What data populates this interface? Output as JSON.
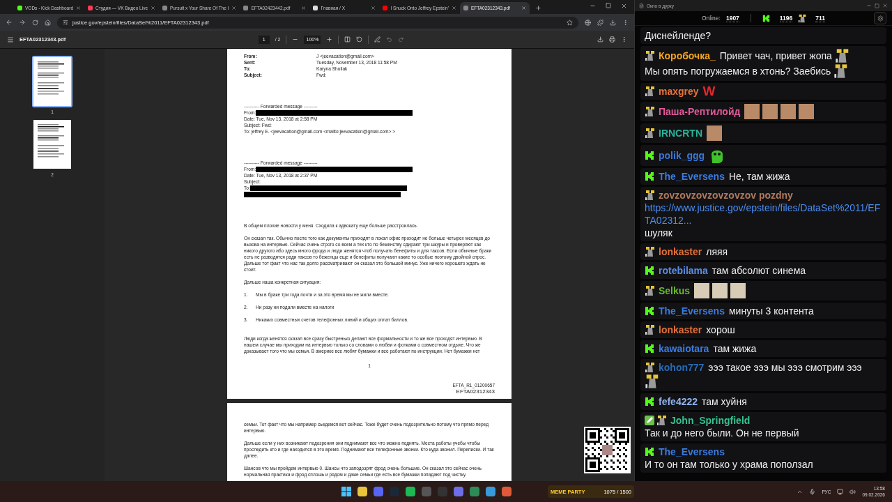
{
  "browser": {
    "tabs": [
      {
        "title": "VODs - Kick Dashboard",
        "selected": false
      },
      {
        "title": "Студия — VK Видео Live",
        "selected": false
      },
      {
        "title": "Pursuit x Your Share Of The I",
        "selected": false
      },
      {
        "title": "EFTA02423442.pdf",
        "selected": false
      },
      {
        "title": "Главная / X",
        "selected": false
      },
      {
        "title": "I Snuck Onto Jeffrey Epstein'",
        "selected": false
      },
      {
        "title": "EFTA02312343.pdf",
        "selected": true
      }
    ],
    "address": "justice.gov/epstein/files/DataSet%2011/EFTA02312343.pdf",
    "pdf_toolbar": {
      "title": "EFTA02312343.pdf",
      "page": "1",
      "page_total": "/ 2",
      "zoom": "100%"
    },
    "thumbnails": [
      {
        "label": "1",
        "selected": true
      },
      {
        "label": "2",
        "selected": false
      }
    ]
  },
  "document": {
    "pages": [
      {
        "blocks": [
          {
            "kind": "fields",
            "rows": [
              {
                "label": "From:",
                "value": "J <jeevacation@gmail.com>"
              },
              {
                "label": "Sent:",
                "value": "Tuesday, November 13, 2018 11:58 PM"
              },
              {
                "label": "To:",
                "value": "Karyna Shuliak"
              },
              {
                "label": "Subject:",
                "value": "Fwd:"
              }
            ]
          },
          {
            "kind": "forward",
            "lines": [
              {
                "text": "---------- Forwarded message ---------",
                "redacted": false
              },
              {
                "text": "From:",
                "redacted": true
              },
              {
                "text": "Date: Tue, Nov 13, 2018 at 2:58 PM",
                "redacted": false
              },
              {
                "text": "Subject: Fwd:",
                "redacted": false
              },
              {
                "text": "To: jeffrey E. <jeevacation@gmail.com <mailto:jeevacation@gmail.com> >",
                "redacted": false
              }
            ]
          },
          {
            "kind": "forward",
            "lines": [
              {
                "text": "---------- Forwarded message ---------",
                "redacted": false
              },
              {
                "text": "From:",
                "redacted": true
              },
              {
                "text": "Date: Tue, Nov 13, 2018 at 2:37 PM",
                "redacted": false
              },
              {
                "text": "Subject:",
                "redacted": false
              },
              {
                "text": "To:",
                "redacted": true
              },
              {
                "redacted": true
              }
            ]
          },
          {
            "kind": "paragraph",
            "text": "В общем плохие новости у меня. Сходила к адвокату еще больше расстроилась."
          },
          {
            "kind": "paragraph",
            "text": "Он сказал так. Обычно после того как документы приходят в локал офис проходит не больше четырех месяцев до вызова на интервью. Сейчас очень строго со всем а тех кто по беженству сдирают три шкуры и проверяют как никого другого ибо здесь много фрода и люди женятся чтоб получать бенефиты и для таксов. Если обычные браки есть не разводятся ради таксов то беженцы еще и бенефиты получают какие то особые поэтому двойной спрос. Дальше тот факт что нас так долго рассматривают он сказал это большой минус. Уже ничего хорошего ждать не стоит."
          },
          {
            "kind": "paragraph",
            "text": "Дальше наша конкретная ситуация:"
          },
          {
            "kind": "list",
            "items": [
              {
                "number": "1.",
                "text": "Мы в браке три года почти и за это время мы не жили вместе."
              },
              {
                "number": "2.",
                "text": "Ни разу ни подали вместе на налоги"
              },
              {
                "number": "3.",
                "text": "Никаких совместных счетов телефонных линий и общих оплат биллов."
              }
            ]
          },
          {
            "kind": "paragraph",
            "text": "Люди когда женятся сказал все сразу быстренько делают все формальности и то же все проходят интервью. В нашем случае мы приходим на интервью только со словами о любви и фотками о совместном отдыхе. Что же доказывает того что мы семья. В америке все любят бумажки и все работают по инструкции. Нет бумажки нет"
          },
          {
            "kind": "page_number",
            "text": "1"
          },
          {
            "kind": "footer",
            "lines": [
              "EFTA_R1_01200657",
              "EFTA02312343"
            ]
          }
        ]
      },
      {
        "blocks": [
          {
            "kind": "paragraph",
            "text": "семьи. Тот факт что мы например сьедемся вот сейчас. Тоже будет очень подозрительно потому что прямо перед интервью."
          },
          {
            "kind": "paragraph",
            "text": "Дальше если у них возникают подозрения они поднимают все что можно поднять. Места работы учебы чтобы проследить кто и где находился в это время. Поднимают все телефонные звонки. Кто куда звонил. Переписки. И так далее."
          },
          {
            "kind": "paragraph",
            "text": "Шансов что мы пройдем интервью 0. Шансы что заподозрят фрод очень большие. Он сказал это сейчас очень нормальная практика и фрод сплошь и рядом и даже семьи где есть все бумажки попадают под чистку."
          }
        ]
      }
    ]
  },
  "chat": {
    "window_title": "Окно в дурку",
    "online_label": "Online:",
    "online": "1907",
    "kick_count": "1196",
    "figure_count": "711",
    "messages": [
      {
        "parts": [
          {
            "kind": "text",
            "text": "Диснейленде?"
          }
        ]
      },
      {
        "badges": [
          {
            "kind": "figure"
          }
        ],
        "user": "Коробочка_",
        "color": "#f5a623",
        "parts": [
          {
            "kind": "text",
            "text": "Привет чач, привет жопа"
          },
          {
            "kind": "figure"
          },
          {
            "kind": "text",
            "text": "Мы опять погружаемся в хтонь? Заебись"
          },
          {
            "kind": "figure"
          }
        ]
      },
      {
        "badges": [
          {
            "kind": "figure"
          }
        ],
        "user": "maxgrey",
        "color": "#e8743b",
        "parts": [
          {
            "kind": "big_letter",
            "text": "W"
          }
        ]
      },
      {
        "badges": [
          {
            "kind": "figure"
          }
        ],
        "user": "Паша-Рептилойд",
        "color": "#e05a9a",
        "parts": [
          {
            "kind": "face"
          },
          {
            "kind": "face"
          },
          {
            "kind": "face"
          },
          {
            "kind": "face"
          }
        ]
      },
      {
        "badges": [
          {
            "kind": "figure"
          }
        ],
        "user": "IRNCRTN",
        "color": "#2bb39a",
        "parts": [
          {
            "kind": "face"
          }
        ]
      },
      {
        "badges": [
          {
            "kind": "kick"
          }
        ],
        "user": "polik_ggg",
        "color": "#3b78d8",
        "parts": [
          {
            "kind": "blob"
          }
        ]
      },
      {
        "badges": [
          {
            "kind": "kick"
          }
        ],
        "user": "The_Eversens",
        "color": "#3b7be0",
        "parts": [
          {
            "kind": "text",
            "text": "Не, там жижа"
          }
        ]
      },
      {
        "badges": [
          {
            "kind": "figure"
          }
        ],
        "user": "zovzovzovzovzovzov pozdny",
        "color": "#b07a5e",
        "parts": [
          {
            "kind": "link",
            "text": "https://www.justice.gov/epstein/files/DataSet%2011/EFTA02312..."
          },
          {
            "kind": "text",
            "text": "шуляк"
          }
        ]
      },
      {
        "badges": [
          {
            "kind": "figure"
          }
        ],
        "user": "lonkaster",
        "color": "#e2703a",
        "parts": [
          {
            "kind": "text",
            "text": "ляяя"
          }
        ]
      },
      {
        "badges": [
          {
            "kind": "kick"
          }
        ],
        "user": "rotebilama",
        "color": "#5b8ee6",
        "parts": [
          {
            "kind": "text",
            "text": "там абсолют синема"
          }
        ]
      },
      {
        "badges": [
          {
            "kind": "figure"
          }
        ],
        "user": "Selkus",
        "color": "#69b832",
        "parts": [
          {
            "kind": "cat"
          },
          {
            "kind": "cat"
          },
          {
            "kind": "cat"
          }
        ]
      },
      {
        "badges": [
          {
            "kind": "kick"
          }
        ],
        "user": "The_Eversens",
        "color": "#3b7be0",
        "parts": [
          {
            "kind": "text",
            "text": "минуты 3 контента"
          }
        ]
      },
      {
        "badges": [
          {
            "kind": "figure"
          }
        ],
        "user": "lonkaster",
        "color": "#e2703a",
        "parts": [
          {
            "kind": "text",
            "text": "хорош"
          }
        ]
      },
      {
        "badges": [
          {
            "kind": "kick"
          }
        ],
        "user": "kawaiotara",
        "color": "#3b7be0",
        "parts": [
          {
            "kind": "text",
            "text": "там жижа"
          }
        ]
      },
      {
        "badges": [
          {
            "kind": "figure"
          }
        ],
        "user": "kohon777",
        "color": "#2a6ab5",
        "parts": [
          {
            "kind": "text",
            "text": "эээ такое эээ мы эээ смотрим эээ"
          },
          {
            "kind": "figure"
          }
        ]
      },
      {
        "badges": [
          {
            "kind": "kick"
          }
        ],
        "user": "fefe4222",
        "color": "#8fb3f0",
        "parts": [
          {
            "kind": "text",
            "text": "там хуйня"
          }
        ]
      },
      {
        "badges": [
          {
            "kind": "pencil"
          },
          {
            "kind": "figure"
          }
        ],
        "user": "John_Springfield",
        "color": "#35c28f",
        "parts": [
          {
            "kind": "text",
            "text": "Так и до него были. Он не первый"
          }
        ]
      },
      {
        "badges": [
          {
            "kind": "kick"
          }
        ],
        "user": "The_Eversens",
        "color": "#3b7be0",
        "parts": [
          {
            "kind": "text",
            "text": "И то он там только у храма поползал"
          }
        ]
      }
    ]
  },
  "overlay": {
    "widget_title": "MEME PARTY",
    "widget_count": "1075 / 1500"
  },
  "taskbar": {
    "language": "РУС",
    "time": "13:58",
    "date": "09.02.2026"
  }
}
